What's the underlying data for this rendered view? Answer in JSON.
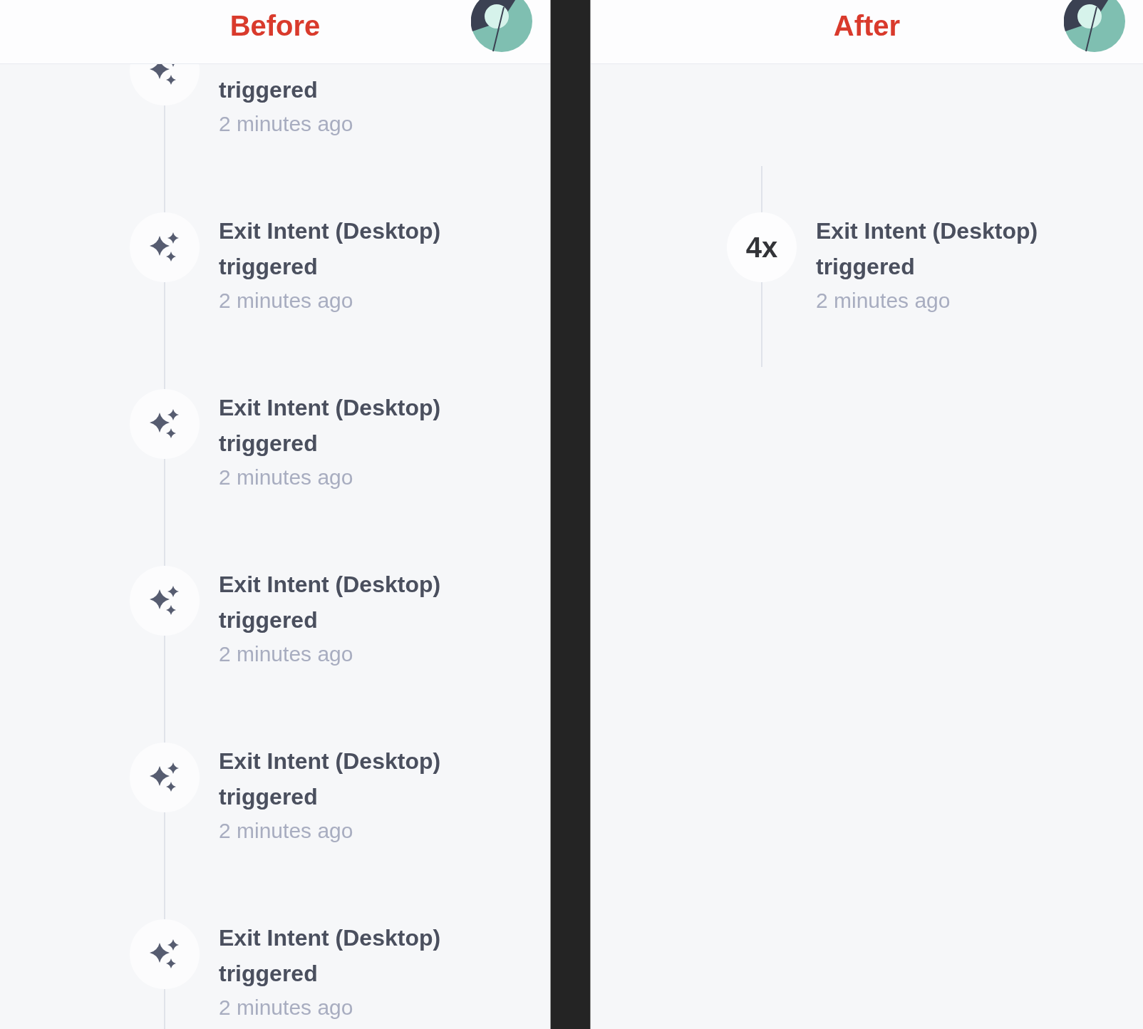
{
  "panels": [
    {
      "title": "Before",
      "events": [
        {
          "kind": "trigger",
          "title": "triggered",
          "time": "2 minutes ago"
        },
        {
          "kind": "trigger",
          "title": "Exit Intent (Desktop) triggered",
          "time": "2 minutes ago"
        },
        {
          "kind": "trigger",
          "title": "Exit Intent (Desktop) triggered",
          "time": "2 minutes ago"
        },
        {
          "kind": "trigger",
          "title": "Exit Intent (Desktop) triggered",
          "time": "2 minutes ago"
        },
        {
          "kind": "trigger",
          "title": "Exit Intent (Desktop) triggered",
          "time": "2 minutes ago"
        },
        {
          "kind": "trigger",
          "title": "Exit Intent (Desktop) triggered",
          "time": "2 minutes ago"
        }
      ]
    },
    {
      "title": "After",
      "events": [
        {
          "kind": "grouped",
          "count": "4x",
          "title": "Exit Intent (Desktop) triggered",
          "time": "2 minutes ago"
        }
      ]
    }
  ]
}
